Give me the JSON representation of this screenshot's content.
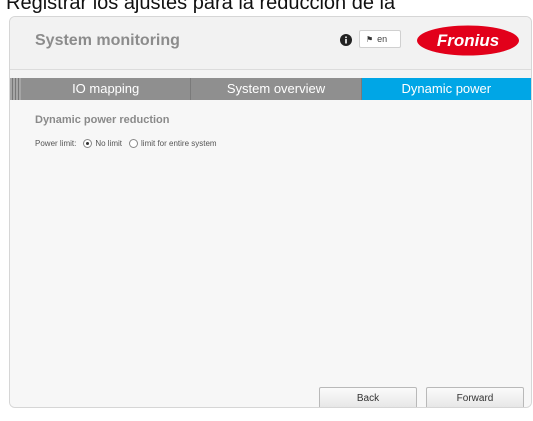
{
  "caption": "Registrar los ajustes para la reducción de la",
  "header": {
    "title": "System monitoring",
    "language": "en",
    "logo_text": "Fronius",
    "brand_color": "#e2001a"
  },
  "tabs": [
    {
      "label": "IO mapping",
      "active": false
    },
    {
      "label": "System overview",
      "active": false
    },
    {
      "label": "Dynamic power",
      "active": true
    }
  ],
  "main": {
    "section_title": "Dynamic power reduction",
    "power_limit": {
      "label": "Power limit:",
      "options": [
        {
          "label": "No limit",
          "selected": true
        },
        {
          "label": "limit for entire system",
          "selected": false
        }
      ]
    }
  },
  "footer": {
    "back_label": "Back",
    "forward_label": "Forward"
  },
  "colors": {
    "active_tab": "#00a6e6",
    "inactive_tab": "#8f8f8f"
  }
}
